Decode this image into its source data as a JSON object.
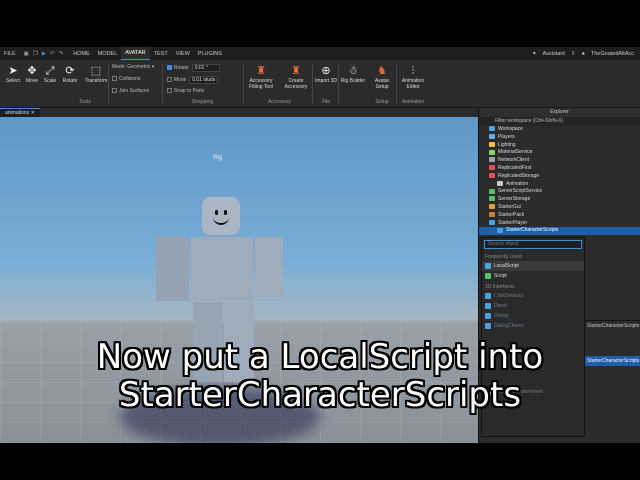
{
  "menubar": {
    "file": "FILE",
    "tabs": [
      "HOME",
      "MODEL",
      "AVATAR",
      "TEST",
      "VIEW",
      "PLUGINS"
    ],
    "active_tab": "AVATAR",
    "assistant": "Assistant",
    "username": "TheGoatedAltAcc"
  },
  "ribbon": {
    "tools": [
      "Select",
      "Move",
      "Scale",
      "Rotate",
      "Transform"
    ],
    "tools_group": "Tools",
    "mode_label": "Mode:",
    "mode_value": "Geometric",
    "collisions": "Collisions",
    "join_surfaces": "Join Surfaces",
    "rotate_label": "Rotate",
    "rotate_value": "0.01 °",
    "move_label": "Move",
    "move_value": "0.01 studs",
    "snap_to_parts": "Snap to Parts",
    "snapping_group": "Snapping",
    "accessory_fitting": "Accessory Fitting Tool",
    "create_accessory": "Create Accessory",
    "accessory_group": "Accessory",
    "import_3d": "Import 3D",
    "file_group": "File",
    "rig_builder": "Rig Builder",
    "avatar_setup": "Avatar Setup",
    "setup_group": "Setup",
    "animation_editor": "Animation Editor",
    "animation_group": "Animation"
  },
  "viewport": {
    "tab_label": "animations",
    "rig_label": "Rig"
  },
  "explorer": {
    "title": "Explorer",
    "filter": "Filter workspace (Ctrl+Shift+X)",
    "items": [
      {
        "label": "Workspace",
        "color": "#4aa3e0",
        "indent": 0
      },
      {
        "label": "Players",
        "color": "#5fb0e6",
        "indent": 0
      },
      {
        "label": "Lighting",
        "color": "#f0c040",
        "indent": 0
      },
      {
        "label": "MaterialService",
        "color": "#8bd16a",
        "indent": 0
      },
      {
        "label": "NetworkClient",
        "color": "#9aa3ad",
        "indent": 0
      },
      {
        "label": "ReplicatedFirst",
        "color": "#e05050",
        "indent": 0
      },
      {
        "label": "ReplicatedStorage",
        "color": "#e05050",
        "indent": 0
      },
      {
        "label": "Animation",
        "color": "#c7c7c7",
        "indent": 1
      },
      {
        "label": "ServerScriptService",
        "color": "#5abf6a",
        "indent": 0
      },
      {
        "label": "ServerStorage",
        "color": "#5abf6a",
        "indent": 0
      },
      {
        "label": "StarterGui",
        "color": "#e0a040",
        "indent": 0
      },
      {
        "label": "StarterPack",
        "color": "#c08040",
        "indent": 0
      },
      {
        "label": "StarterPlayer",
        "color": "#4aa3e0",
        "indent": 0
      },
      {
        "label": "StarterCharacterScripts",
        "color": "#4aa3e0",
        "indent": 1,
        "selected": true
      }
    ]
  },
  "popup": {
    "search_placeholder": "Search object",
    "section_frequent": "Frequently Used",
    "items": [
      {
        "label": "LocalScript",
        "color": "#4aa3e0",
        "highlight": true
      },
      {
        "label": "Script",
        "color": "#5abf6a"
      }
    ],
    "section_3d": "3D Interfaces",
    "dim_items": [
      {
        "label": "ClickDetector",
        "color": "#4aa3e0"
      },
      {
        "label": "Decal",
        "color": "#4aa3e0"
      },
      {
        "label": "Dialog",
        "color": "#4aa3e0"
      },
      {
        "label": "DialogChoice",
        "color": "#4aa3e0"
      }
    ],
    "bottom_item": "BoxHandleAdornment"
  },
  "properties": {
    "title": "StarterCharacterScripts",
    "selected": "StarterCharacterScripts"
  },
  "caption": {
    "line1": "Now put a LocalScript into",
    "line2": "StarterCharacterScripts"
  },
  "colors": {
    "accent": "#3c8dde",
    "panel": "#2b2b2b",
    "selection": "#1f5fa8"
  }
}
